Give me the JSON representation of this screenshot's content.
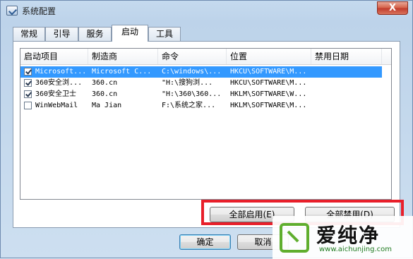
{
  "window": {
    "title": "系统配置",
    "close_label": "X"
  },
  "tabs": [
    {
      "label": "常规"
    },
    {
      "label": "引导"
    },
    {
      "label": "服务"
    },
    {
      "label": "启动"
    },
    {
      "label": "工具"
    }
  ],
  "startup": {
    "columns": [
      "启动项目",
      "制造商",
      "命令",
      "位置",
      "禁用日期"
    ],
    "rows": [
      {
        "checked": true,
        "selected": true,
        "item": "Microsoft...",
        "maker": "Microsoft C...",
        "command": "C:\\windows\\...",
        "location": "HKCU\\SOFTWARE\\M...",
        "disabled": ""
      },
      {
        "checked": true,
        "selected": false,
        "item": "360安全浏...",
        "maker": "360.cn",
        "command": "\"H:\\搜狗浏...",
        "location": "HKCU\\SOFTWARE\\M...",
        "disabled": ""
      },
      {
        "checked": true,
        "selected": false,
        "item": "360安全卫士",
        "maker": "360.cn",
        "command": "\"H:\\360\\360...",
        "location": "HKLM\\SOFTWARE\\W...",
        "disabled": ""
      },
      {
        "checked": false,
        "selected": false,
        "item": "WinWebMail",
        "maker": "Ma Jian",
        "command": "F:\\系统之家...",
        "location": "HKLM\\SOFTWARE\\M...",
        "disabled": ""
      }
    ]
  },
  "buttons": {
    "enable_all": "全部启用(E)",
    "disable_all": "全部禁用(D)",
    "ok": "确定",
    "cancel": "取消"
  },
  "watermark": {
    "name": "爱纯净",
    "url": "www.aichunjing.com"
  },
  "colors": {
    "selection": "#3399ff",
    "highlight": "#e81f2a",
    "watermark_green": "#5fae2e"
  }
}
